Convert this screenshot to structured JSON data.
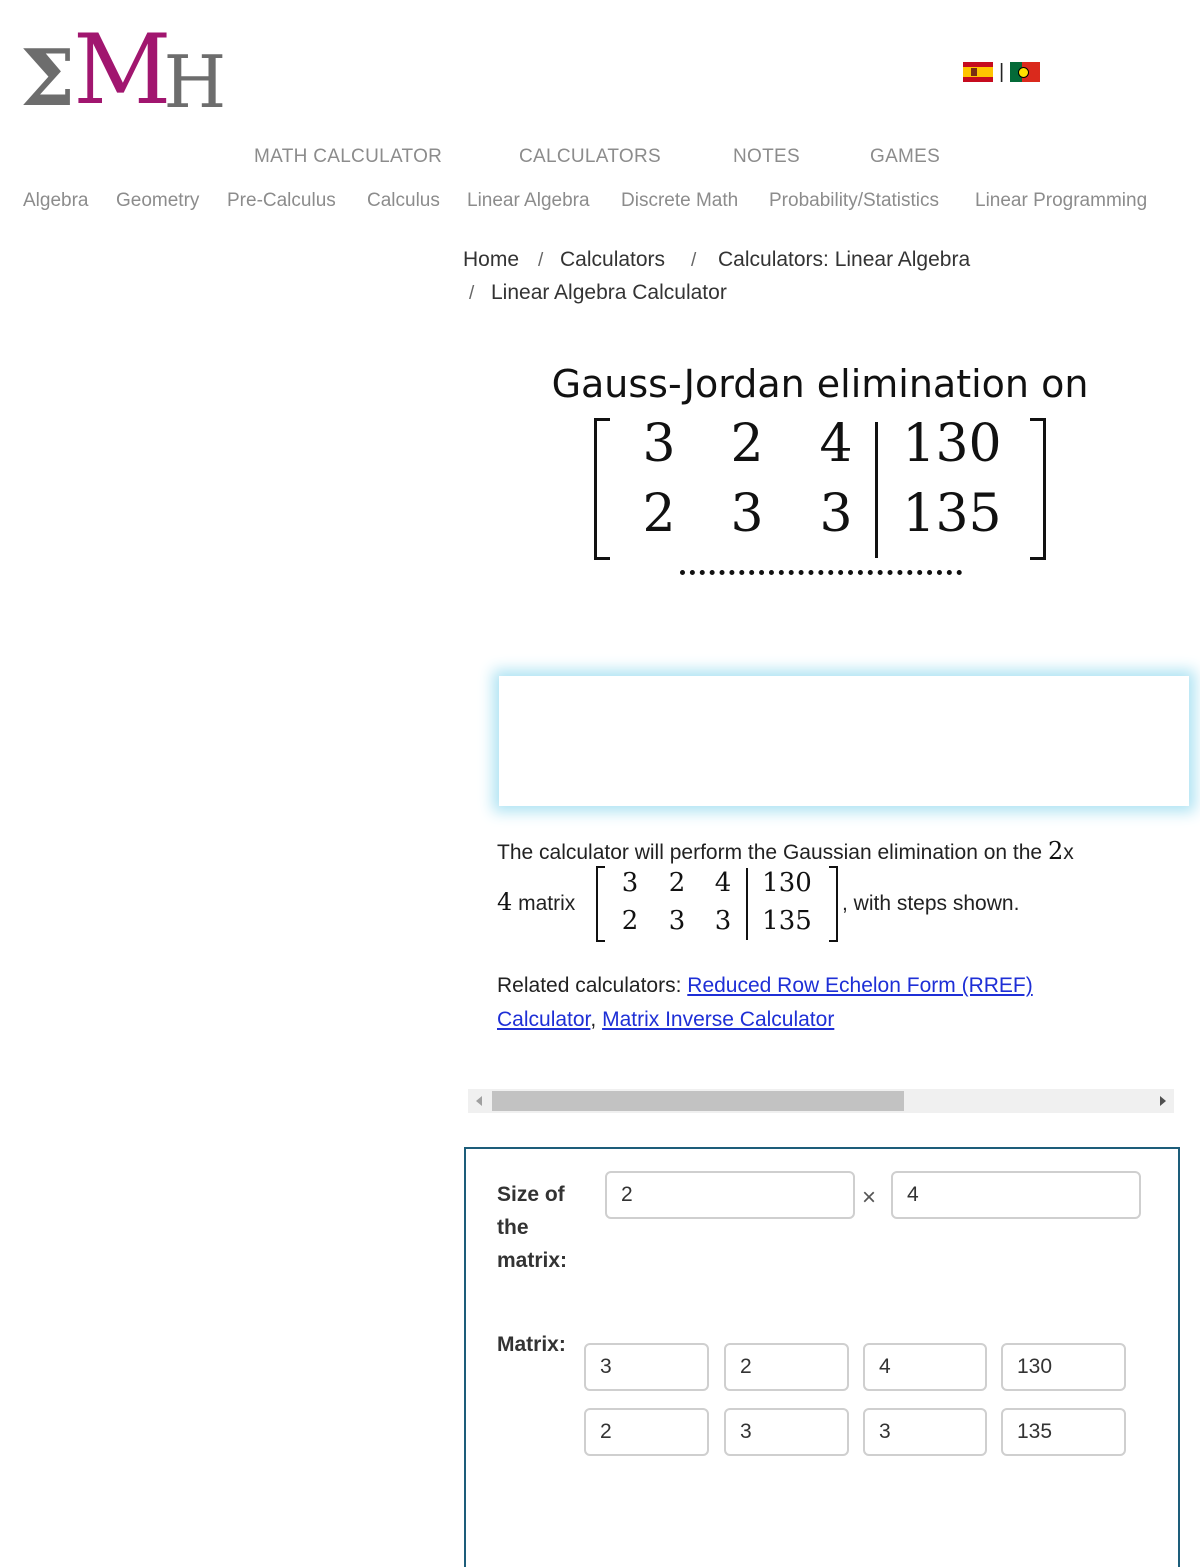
{
  "logo": {
    "sigma": "Σ",
    "m": "M",
    "h": "H"
  },
  "nav": {
    "top": [
      "MATH CALCULATOR",
      "CALCULATORS",
      "NOTES",
      "GAMES"
    ],
    "sub": [
      "Algebra",
      "Geometry",
      "Pre-Calculus",
      "Calculus",
      "Linear Algebra",
      "Discrete Math",
      "Probability/Statistics",
      "Linear Programming"
    ]
  },
  "flags_sep": "|",
  "breadcrumb": {
    "items": [
      "Home",
      "Calculators",
      "Calculators: Linear Algebra",
      "Linear Algebra Calculator"
    ],
    "sep": "/"
  },
  "title": "Gauss-Jordan elimination on",
  "matrix": {
    "rows": [
      [
        "3",
        "2",
        "4",
        "130"
      ],
      [
        "2",
        "3",
        "3",
        "135"
      ]
    ]
  },
  "description": {
    "line1": "The calculator will perform the Gaussian elimination on the",
    "rows_count": "2",
    "x": "x",
    "cols_count": "4",
    "matrix_word": "matrix",
    "suffix": ", with steps shown."
  },
  "related": {
    "label": "Related calculators:",
    "link1_a": "Reduced Row Echelon Form (RREF)",
    "link1_b": "Calculator",
    "comma": ",",
    "link2": "Matrix Inverse Calculator"
  },
  "form": {
    "size_label": [
      "Size of",
      "the",
      "matrix:"
    ],
    "rows_value": "2",
    "times": "×",
    "cols_value": "4",
    "matrix_label": "Matrix:",
    "cells": [
      [
        "3",
        "2",
        "4",
        "130"
      ],
      [
        "2",
        "3",
        "3",
        "135"
      ]
    ]
  }
}
